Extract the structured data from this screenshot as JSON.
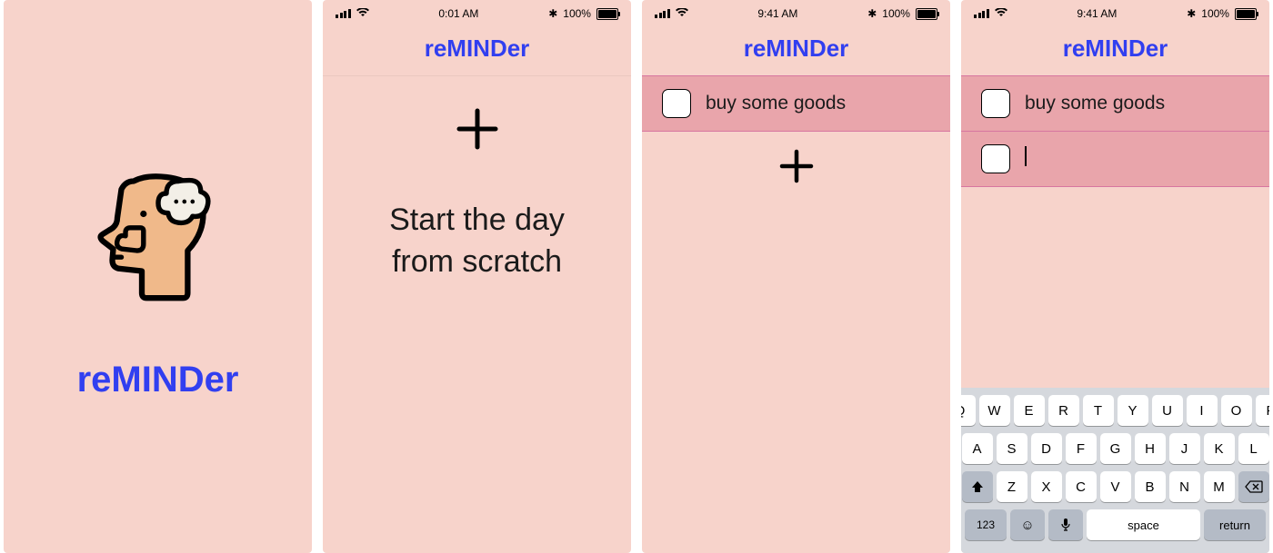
{
  "app": {
    "name": "reMINDer"
  },
  "status": {
    "time1": "0:01 AM",
    "time2": "9:41 AM",
    "batteryText": "100%"
  },
  "screen2": {
    "tagline": "Start the day\nfrom scratch"
  },
  "screen3": {
    "items": [
      {
        "text": "buy some goods"
      }
    ]
  },
  "screen4": {
    "items": [
      {
        "text": "buy some goods"
      }
    ],
    "editingText": ""
  },
  "keyboard": {
    "row1": [
      "Q",
      "W",
      "E",
      "R",
      "T",
      "Y",
      "U",
      "I",
      "O",
      "P"
    ],
    "row2": [
      "A",
      "S",
      "D",
      "F",
      "G",
      "H",
      "J",
      "K",
      "L"
    ],
    "row3": [
      "Z",
      "X",
      "C",
      "V",
      "B",
      "N",
      "M"
    ],
    "numLabel": "123",
    "spaceLabel": "space",
    "returnLabel": "return"
  }
}
